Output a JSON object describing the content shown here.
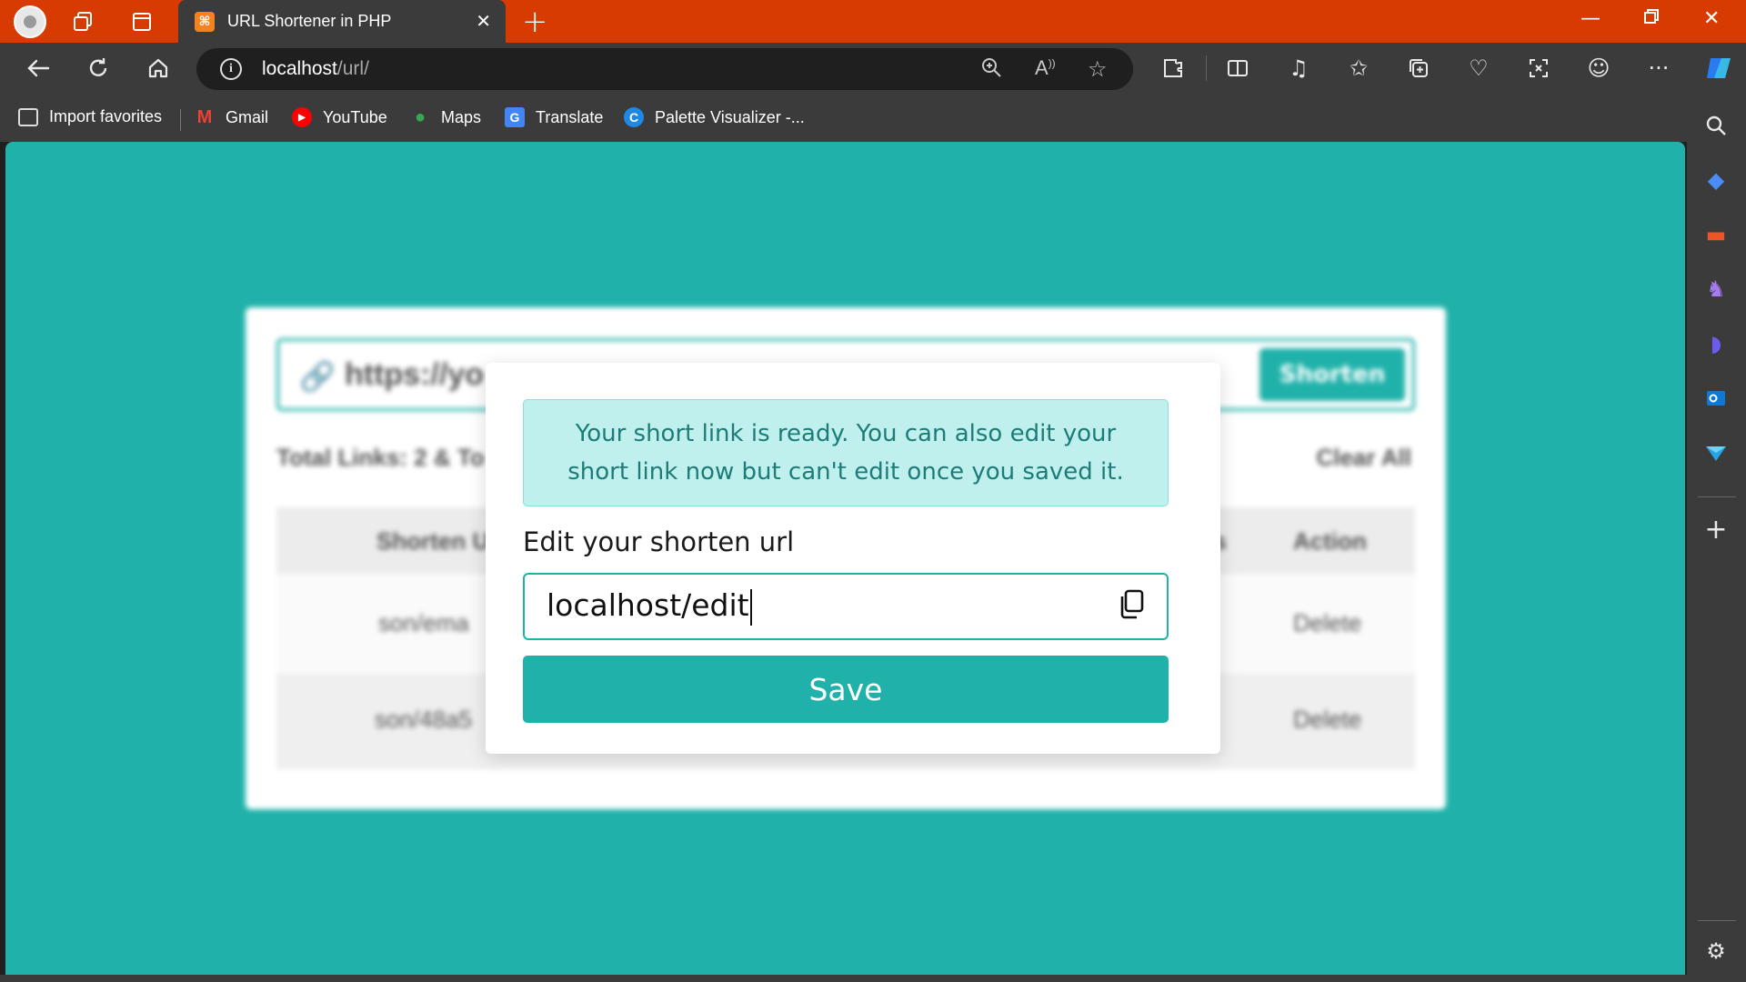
{
  "browser": {
    "tab_title": "URL Shortener in PHP",
    "tab_favicon_glyph": "⌘",
    "new_tab_glyph": "+",
    "address_host": "localhost",
    "address_path": "/url/",
    "bookmarks": [
      {
        "label": "Import favorites",
        "icon": "import-icon"
      },
      {
        "label": "Gmail",
        "icon": "gmail-icon"
      },
      {
        "label": "YouTube",
        "icon": "youtube-icon"
      },
      {
        "label": "Maps",
        "icon": "maps-icon"
      },
      {
        "label": "Translate",
        "icon": "translate-icon"
      },
      {
        "label": "Palette Visualizer -...",
        "icon": "palette-icon"
      }
    ],
    "accent_color": "#d83b01"
  },
  "page": {
    "background_color": "#20b2aa",
    "background_card": {
      "url_input_value": "https://yo",
      "shorten_button": "Shorten",
      "total_links": "Total Links: 2 & To",
      "clear_all": "Clear All",
      "table_headers": [
        "Shorten U",
        "ks",
        "Action"
      ],
      "rows": [
        {
          "short": "son/ema",
          "action": "Delete"
        },
        {
          "short": "son/48a5",
          "action": "Delete"
        }
      ]
    },
    "modal": {
      "alert_text": "Your short link is ready. You can also edit your short link now but can't edit once you saved it.",
      "edit_label": "Edit your shorten url",
      "edit_value": "localhost/edit",
      "save_label": "Save",
      "copy_icon": "copy-icon"
    }
  }
}
